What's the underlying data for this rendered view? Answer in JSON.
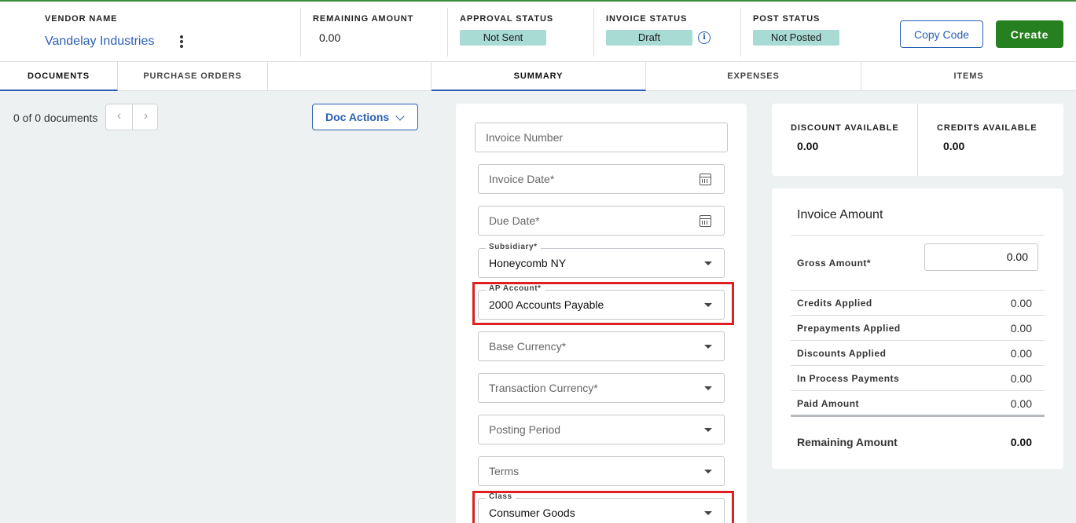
{
  "header": {
    "vendor_label": "VENDOR NAME",
    "vendor_name": "Vandelay Industries",
    "remaining_label": "REMAINING AMOUNT",
    "remaining_value": "0.00",
    "approval_label": "APPROVAL STATUS",
    "approval_value": "Not Sent",
    "invoice_status_label": "INVOICE STATUS",
    "invoice_status_value": "Draft",
    "post_status_label": "POST STATUS",
    "post_status_value": "Not Posted",
    "copy_code_label": "Copy Code",
    "create_label": "Create",
    "info_glyph": "i"
  },
  "tabs": {
    "left": [
      {
        "label": "DOCUMENTS",
        "active": true
      },
      {
        "label": "PURCHASE ORDERS",
        "active": false
      }
    ],
    "right": [
      {
        "label": "SUMMARY",
        "active": true
      },
      {
        "label": "EXPENSES",
        "active": false
      },
      {
        "label": "ITEMS",
        "active": false
      }
    ]
  },
  "documents": {
    "count_text": "0 of 0 documents",
    "prev_glyph": "‹",
    "next_glyph": "›",
    "doc_actions_label": "Doc Actions"
  },
  "form": {
    "invoice_number_placeholder": "Invoice Number",
    "invoice_date_placeholder": "Invoice Date*",
    "due_date_placeholder": "Due Date*",
    "subsidiary_label": "Subsidiary*",
    "subsidiary_value": "Honeycomb NY",
    "ap_account_label": "AP Account*",
    "ap_account_value": "2000 Accounts Payable",
    "base_currency_placeholder": "Base Currency*",
    "transaction_currency_placeholder": "Transaction Currency*",
    "posting_period_placeholder": "Posting Period",
    "terms_placeholder": "Terms",
    "class_label": "Class",
    "class_value": "Consumer Goods"
  },
  "availability": {
    "discount_label": "DISCOUNT AVAILABLE",
    "discount_value": "0.00",
    "credits_label": "CREDITS AVAILABLE",
    "credits_value": "0.00"
  },
  "invoice_amount": {
    "title": "Invoice Amount",
    "gross_label": "Gross Amount*",
    "gross_value": "0.00",
    "rows": [
      {
        "label": "Credits Applied",
        "value": "0.00"
      },
      {
        "label": "Prepayments Applied",
        "value": "0.00"
      },
      {
        "label": "Discounts Applied",
        "value": "0.00"
      },
      {
        "label": "In Process Payments",
        "value": "0.00"
      },
      {
        "label": "Paid Amount",
        "value": "0.00"
      }
    ],
    "remaining_label": "Remaining Amount",
    "remaining_value": "0.00"
  },
  "colors": {
    "accent": "#2b5fb3",
    "create_button": "#26801f",
    "status_pill": "#a9dbd5",
    "highlight": "#e02020",
    "background": "#eef1f2"
  }
}
